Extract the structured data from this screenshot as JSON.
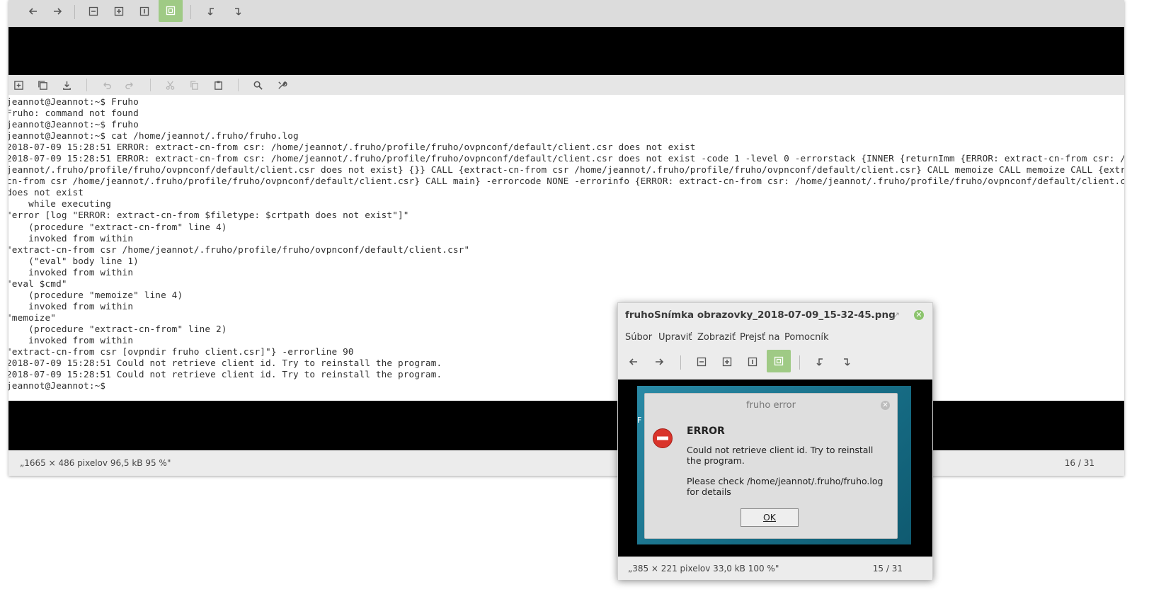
{
  "main_window": {
    "toolbar_icons": [
      "arrow-left-icon",
      "arrow-right-icon",
      "zoom-out-icon",
      "zoom-in-icon",
      "zoom-actual-icon",
      "zoom-fit-icon",
      "rotate-left-icon",
      "rotate-right-icon"
    ],
    "terminal_toolbar_icons": [
      "new-tab-icon",
      "new-window-icon",
      "save-icon",
      "undo-icon",
      "redo-icon",
      "cut-icon",
      "copy-icon",
      "paste-icon",
      "search-icon",
      "settings-icon"
    ],
    "terminal_lines": [
      "jeannot@Jeannot:~$ Fruho",
      "Fruho: command not found",
      "jeannot@Jeannot:~$ fruho",
      "jeannot@Jeannot:~$ cat /home/jeannot/.fruho/fruho.log",
      "2018-07-09 15:28:51 ERROR: extract-cn-from csr: /home/jeannot/.fruho/profile/fruho/ovpnconf/default/client.csr does not exist",
      "2018-07-09 15:28:51 ERROR: extract-cn-from csr: /home/jeannot/.fruho/profile/fruho/ovpnconf/default/client.csr does not exist -code 1 -level 0 -errorstack {INNER {returnImm {ERROR: extract-cn-from csr: /home/",
      "jeannot/.fruho/profile/fruho/ovpnconf/default/client.csr does not exist} {}} CALL {extract-cn-from csr /home/jeannot/.fruho/profile/fruho/ovpnconf/default/client.csr} CALL memoize CALL memoize CALL {extract-",
      "cn-from csr /home/jeannot/.fruho/profile/fruho/ovpnconf/default/client.csr} CALL main} -errorcode NONE -errorinfo {ERROR: extract-cn-from csr: /home/jeannot/.fruho/profile/fruho/ovpnconf/default/client.csr",
      "does not exist",
      "    while executing",
      "\"error [log \"ERROR: extract-cn-from $filetype: $crtpath does not exist\"]\"",
      "    (procedure \"extract-cn-from\" line 4)",
      "    invoked from within",
      "\"extract-cn-from csr /home/jeannot/.fruho/profile/fruho/ovpnconf/default/client.csr\"",
      "    (\"eval\" body line 1)",
      "    invoked from within",
      "\"eval $cmd\"",
      "    (procedure \"memoize\" line 4)",
      "    invoked from within",
      "\"memoize\"",
      "    (procedure \"extract-cn-from\" line 2)",
      "    invoked from within",
      "\"extract-cn-from csr [ovpndir fruho client.csr]\"} -errorline 90",
      "2018-07-09 15:28:51 Could not retrieve client id. Try to reinstall the program.",
      "2018-07-09 15:28:51 Could not retrieve client id. Try to reinstall the program.",
      "jeannot@Jeannot:~$"
    ],
    "status_info": "„1665 × 486 pixelov  96,5 kB    95 %\"",
    "status_count": "16 / 31"
  },
  "second_window": {
    "title": "fruhoSnímka obrazovky_2018-07-09_15-32-45.png",
    "menu": [
      "Súbor",
      "Upraviť",
      "Zobraziť",
      "Prejsť na",
      "Pomocník"
    ],
    "status_info": "„385 × 221 pixelov  33,0 kB    100 %\"",
    "status_count": "15 / 31",
    "fragment_text": "F",
    "dialog": {
      "title": "fruho error",
      "heading": "ERROR",
      "message": "Could not retrieve client id. Try to reinstall the program.",
      "detail": "Please check /home/jeannot/.fruho/fruho.log for details",
      "ok_label": "OK"
    }
  },
  "colors": {
    "active_button": "#9fca85",
    "close_button": "#8cc46d",
    "desktop_bg": "#1c7893",
    "error_red": "#d9342b"
  }
}
